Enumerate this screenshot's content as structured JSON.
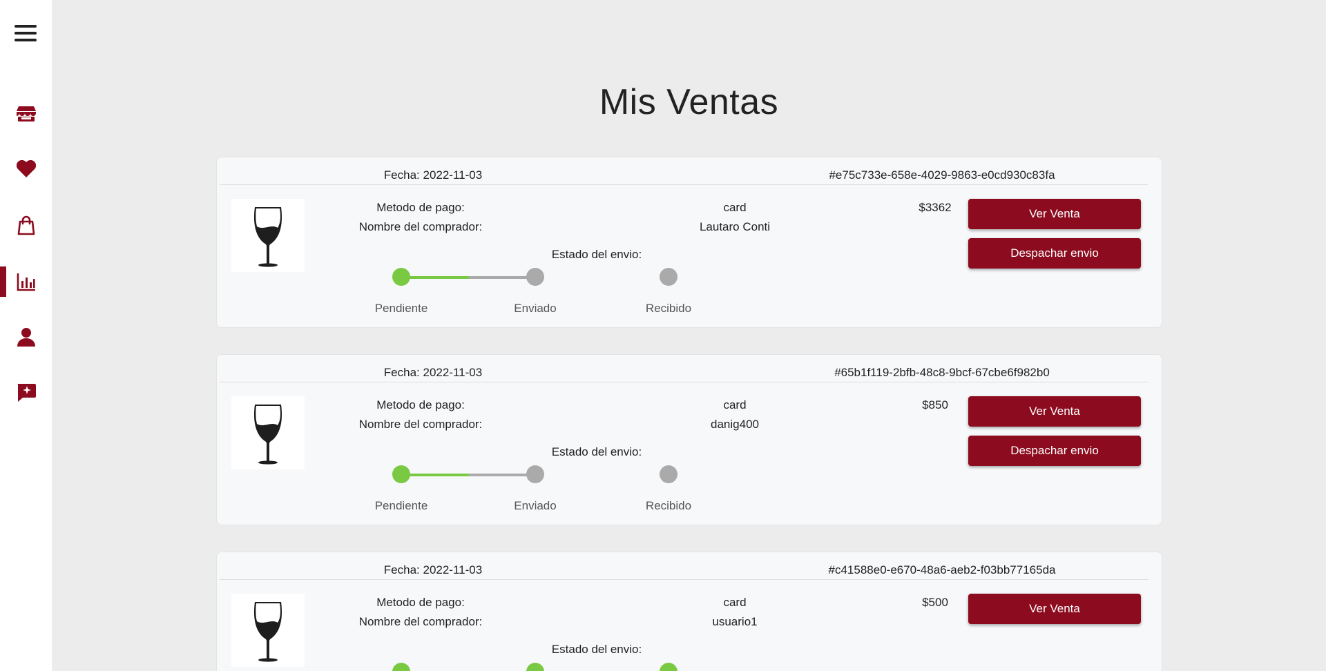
{
  "page": {
    "title": "Mis Ventas"
  },
  "sidebar": {
    "items": [
      {
        "icon": "store-icon"
      },
      {
        "icon": "heart-icon"
      },
      {
        "icon": "shopping-bag-icon"
      },
      {
        "icon": "bar-chart-icon",
        "active": true
      },
      {
        "icon": "user-icon"
      },
      {
        "icon": "feedback-icon"
      }
    ],
    "accent": "#8c0b1e"
  },
  "labels": {
    "payment_method": "Metodo de pago:",
    "buyer_name": "Nombre del comprador:",
    "shipping_status": "Estado del envio:",
    "view_sale": "Ver Venta",
    "dispatch": "Despachar envio"
  },
  "steps": [
    "Pendiente",
    "Enviado",
    "Recibido"
  ],
  "colors": {
    "done": "#7ac943",
    "pending": "#aaaaaa",
    "button": "#8c0b1e"
  },
  "orders": [
    {
      "date": "Fecha: 2022-11-03",
      "id": "#e75c733e-658e-4029-9863-e0cd930c83fa",
      "payment": "card",
      "buyer": "Lautaro Conti",
      "price": "$3362",
      "status_index": 0,
      "can_dispatch": true
    },
    {
      "date": "Fecha: 2022-11-03",
      "id": "#65b1f119-2bfb-48c8-9bcf-67cbe6f982b0",
      "payment": "card",
      "buyer": "danig400",
      "price": "$850",
      "status_index": 0,
      "can_dispatch": true
    },
    {
      "date": "Fecha: 2022-11-03",
      "id": "#c41588e0-e670-48a6-aeb2-f03bb77165da",
      "payment": "card",
      "buyer": "usuario1",
      "price": "$500",
      "status_index": 2,
      "can_dispatch": false
    }
  ]
}
